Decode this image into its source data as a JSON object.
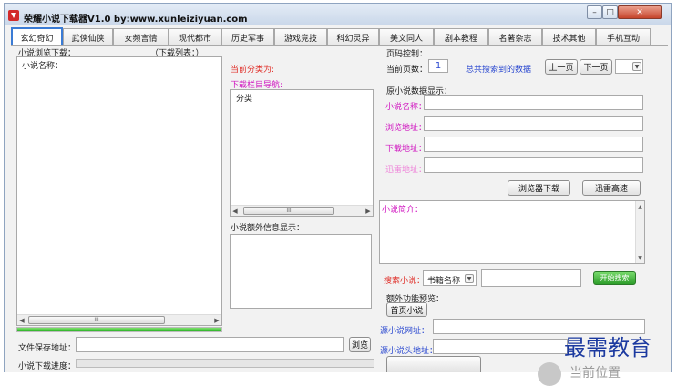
{
  "window": {
    "title": "荣耀小说下载器V1.0 by:www.xunleiziyuan.com",
    "controls": {
      "minimize": "–",
      "maximize": "□",
      "close": "✕"
    }
  },
  "tabs": [
    "玄幻奇幻",
    "武侠仙侠",
    "女频言情",
    "现代都市",
    "历史军事",
    "游戏竞技",
    "科幻灵异",
    "美文同人",
    "剧本教程",
    "名著杂志",
    "技术其他",
    "手机互动"
  ],
  "left": {
    "browse_title": "小说浏览下载：",
    "download_list_label": "（下载列表：）",
    "list_header": "小说名称：",
    "hscroll_thumb": "III",
    "save_path_label": "文件保存地址：",
    "save_path_value": "",
    "browse_button": "浏览",
    "progress_label": "小说下载进度：",
    "top_progress_pct": 100
  },
  "middle": {
    "current_category_label": "当前分类为:",
    "nav_label": "下载栏目导航:",
    "category_header": "分类",
    "hscroll_thumb": "III",
    "extra_info_label": "小说额外信息显示："
  },
  "right": {
    "page_control_title": "页码控制：",
    "current_page_label": "当前页数：",
    "current_page_value": "1",
    "total_data_label": "总共搜索到的数据",
    "prev_button": "上一页",
    "next_button": "下一页",
    "original_data_title": "原小说数据显示：",
    "novel_name_label": "小说名称：",
    "browse_url_label": "浏览地址：",
    "download_url_label": "下载地址：",
    "thunder_url_label": "迅雷地址：",
    "browser_download_button": "浏览器下载",
    "thunder_speed_button": "迅雷高速",
    "intro_label": "小说简介：",
    "search_label": "搜索小说：",
    "search_type_value": "书籍名称",
    "search_input_value": "",
    "search_button": "开始搜索",
    "extra_func_title": "额外功能预览：",
    "home_novel_button": "首页小说",
    "source_url_label": "源小说网址：",
    "source_header_label": "源小说头地址：",
    "partial_text": "当前位置"
  },
  "watermark": "最需教育",
  "colors": {
    "red": "#e0302a",
    "magenta": "#d015c0",
    "pink": "#ee7fd8",
    "blue": "#2a48d0",
    "tab_active_border": "#3a7bd5",
    "progress_green": "#2fb52a"
  }
}
